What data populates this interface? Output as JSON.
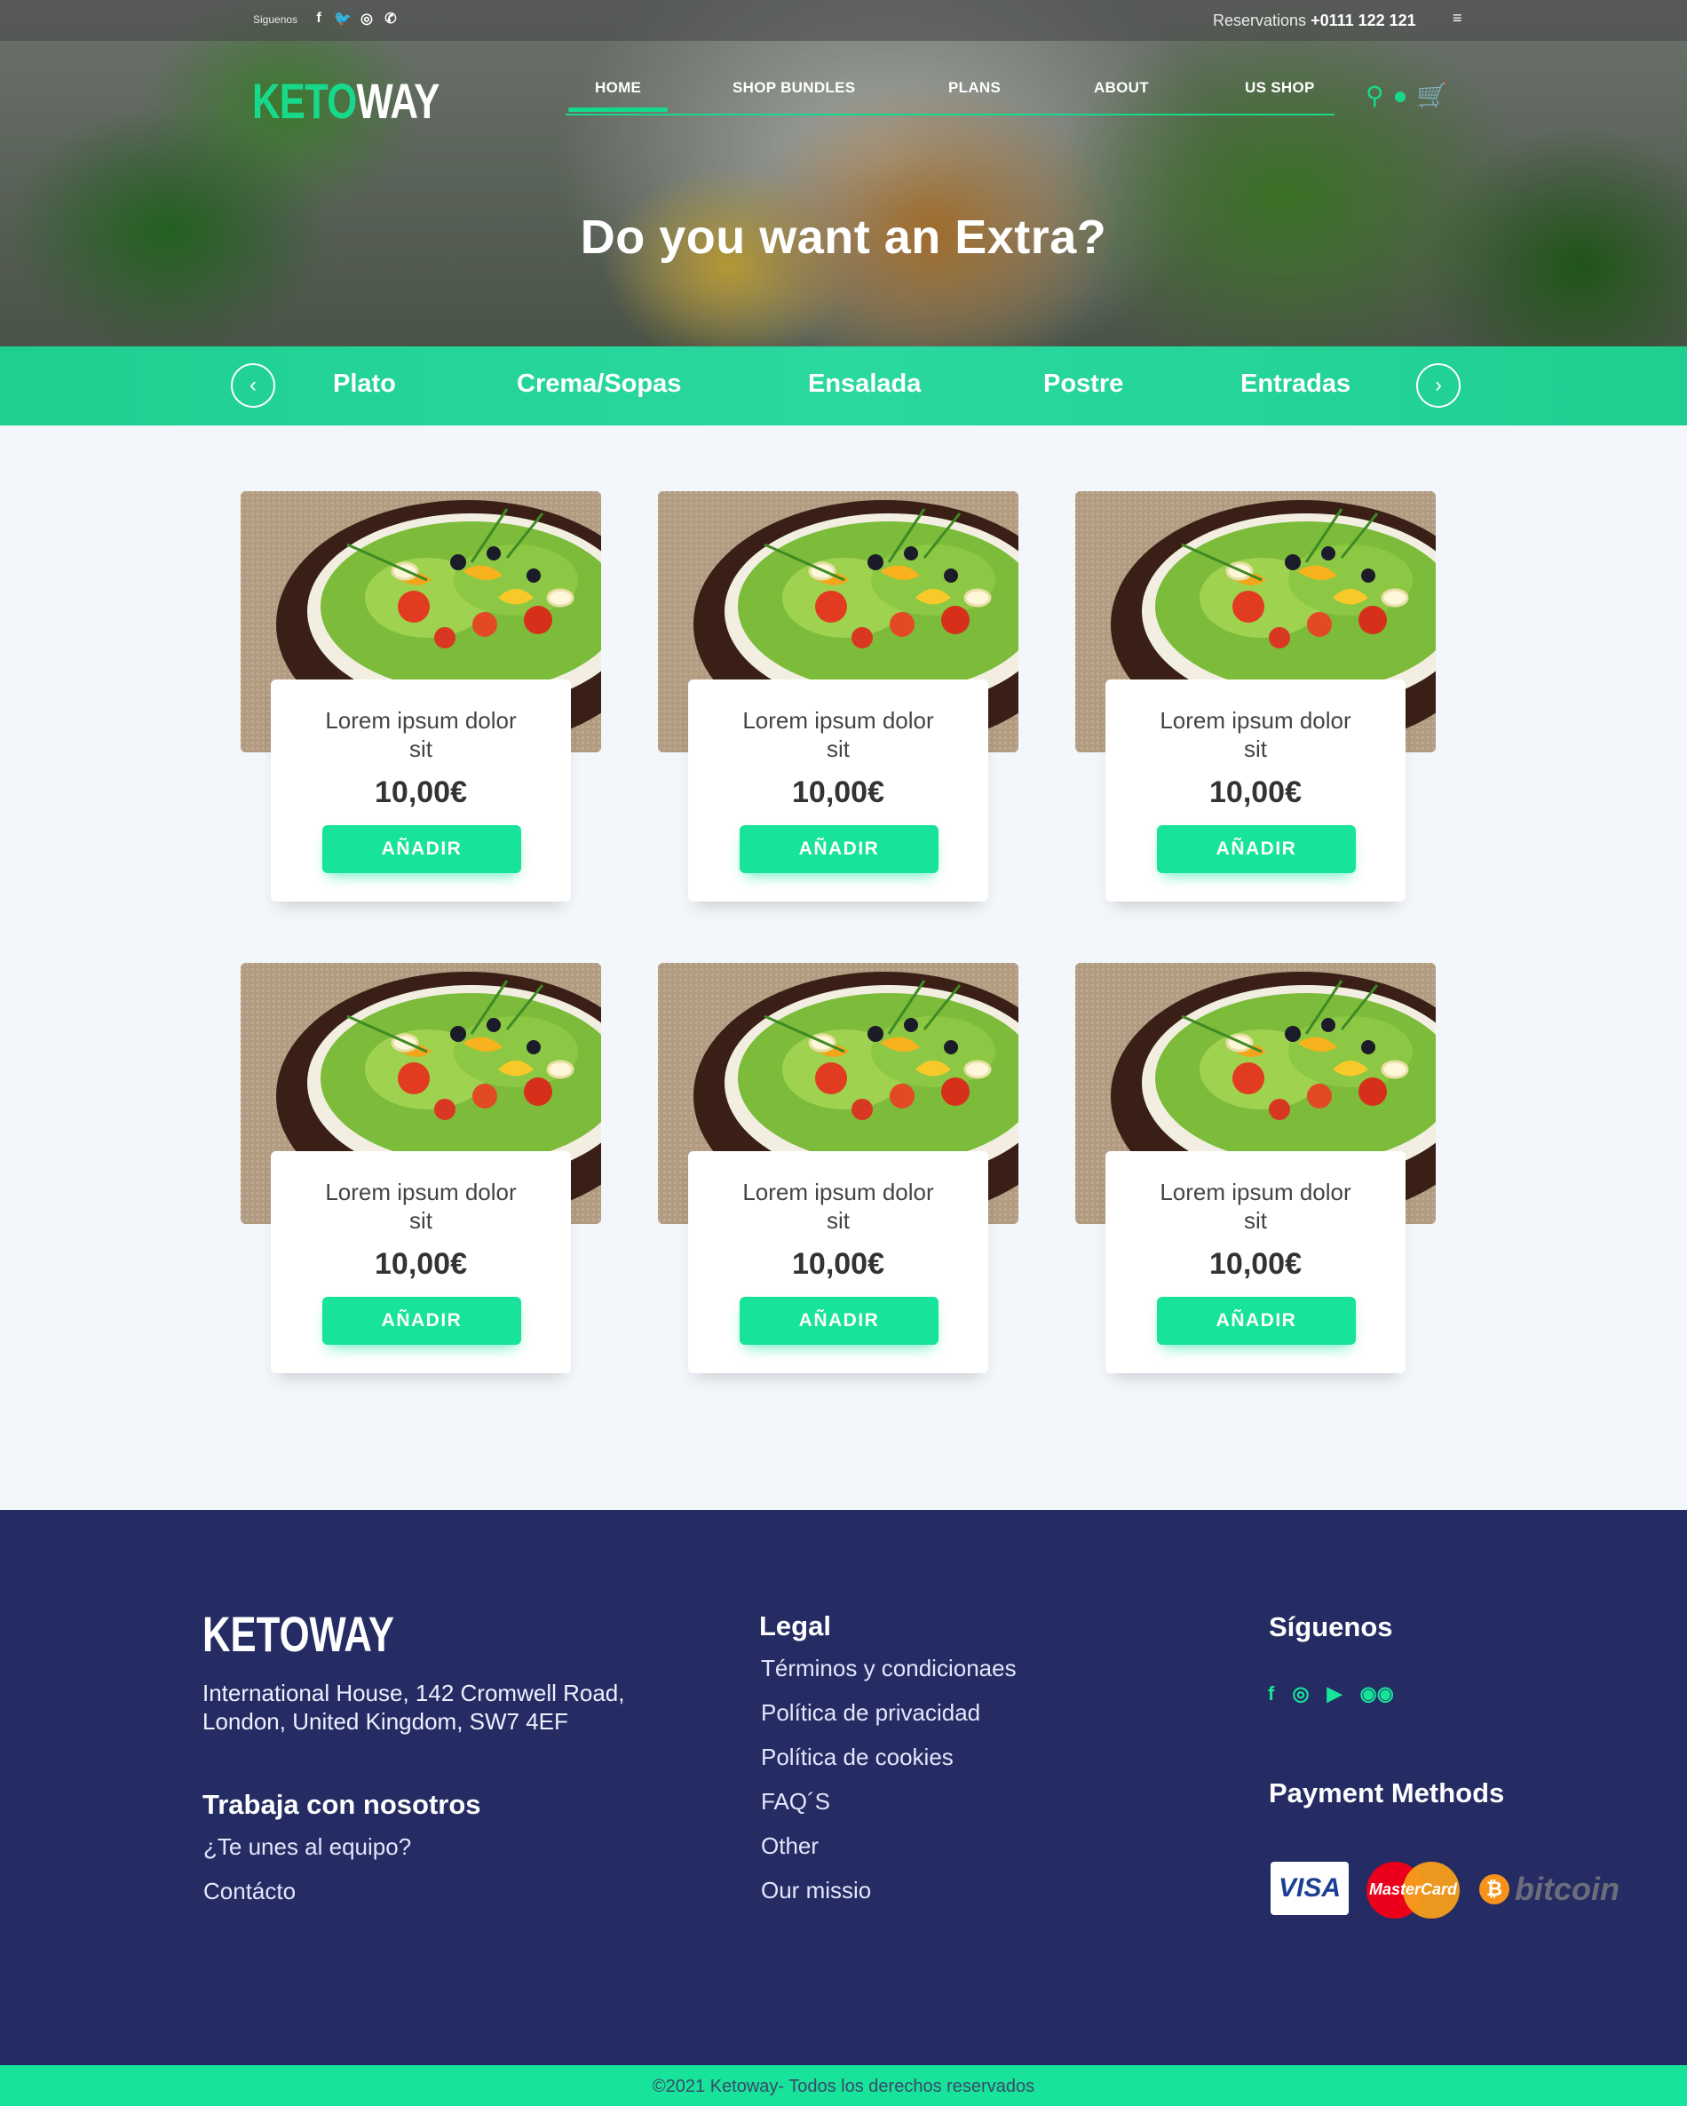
{
  "topbar": {
    "follow_label": "Siguenos",
    "social_icons": [
      "facebook-icon",
      "twitter-icon",
      "instagram-icon",
      "whatsapp-icon"
    ],
    "reservations_label": "Reservations",
    "reservations_phone": "+0111 122 121"
  },
  "header": {
    "logo_part1": "KET",
    "logo_part2": "O",
    "logo_part3": "WAY",
    "nav": [
      {
        "label": "HOME",
        "active": true
      },
      {
        "label": "SHOP BUNDLES"
      },
      {
        "label": "PLANS"
      },
      {
        "label": "ABOUT"
      },
      {
        "label": "US SHOP"
      }
    ],
    "icons": [
      "search-icon",
      "user-icon",
      "cart-icon"
    ]
  },
  "hero": {
    "title": "Do you want an Extra?"
  },
  "categories": {
    "items": [
      "Plato",
      "Crema/Sopas",
      "Ensalada",
      "Postre",
      "Entradas"
    ],
    "prev_icon": "‹",
    "next_icon": "›"
  },
  "products": [
    {
      "name": "Lorem ipsum dolor sit",
      "price": "10,00€",
      "button": "AÑADIR"
    },
    {
      "name": "Lorem ipsum dolor sit",
      "price": "10,00€",
      "button": "AÑADIR"
    },
    {
      "name": "Lorem ipsum dolor sit",
      "price": "10,00€",
      "button": "AÑADIR"
    },
    {
      "name": "Lorem ipsum dolor sit",
      "price": "10,00€",
      "button": "AÑADIR"
    },
    {
      "name": "Lorem ipsum dolor sit",
      "price": "10,00€",
      "button": "AÑADIR"
    },
    {
      "name": "Lorem ipsum dolor sit",
      "price": "10,00€",
      "button": "AÑADIR"
    }
  ],
  "footer": {
    "logo": "KETOWAY",
    "address_line1": "International House, 142 Cromwell Road,",
    "address_line2": "London, United Kingdom, SW7 4EF",
    "work_heading": "Trabaja con nosotros",
    "work_links": [
      "¿Te unes al equipo?",
      "Contácto"
    ],
    "legal_heading": "Legal",
    "legal_links": [
      "Términos y condicionaes",
      "Política de privacidad",
      "Política de cookies",
      "FAQ´S",
      "Other",
      "Our missio"
    ],
    "social_heading": "Síguenos",
    "social_icons": [
      "facebook-icon",
      "instagram-icon",
      "youtube-icon",
      "tripadvisor-icon"
    ],
    "payment_heading": "Payment Methods",
    "payment_visa": "VISA",
    "payment_mastercard": "MasterCard",
    "payment_bitcoin": "bitcoin",
    "copyright": "©2021 Ketoway- Todos los derechos reservados"
  },
  "colors": {
    "accent": "#17e39a",
    "footer_bg": "#242c63",
    "category_bar": "#1fcf8f",
    "page_bg": "#f3f7fb"
  }
}
